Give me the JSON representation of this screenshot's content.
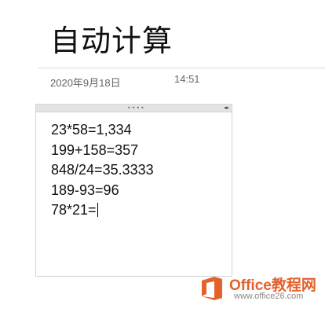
{
  "page": {
    "title": "自动计算",
    "date": "2020年9月18日",
    "time": "14:51"
  },
  "note": {
    "grip_glyph": "••••",
    "resize_glyph": "◂▸",
    "lines": [
      "23*58=1,334",
      "199+158=357",
      "848/24=35.3333",
      "189-93=96",
      "78*21="
    ]
  },
  "watermark": {
    "brand": "Office教程网",
    "url": "www.office26.com",
    "logo_color": "#e4612d"
  }
}
